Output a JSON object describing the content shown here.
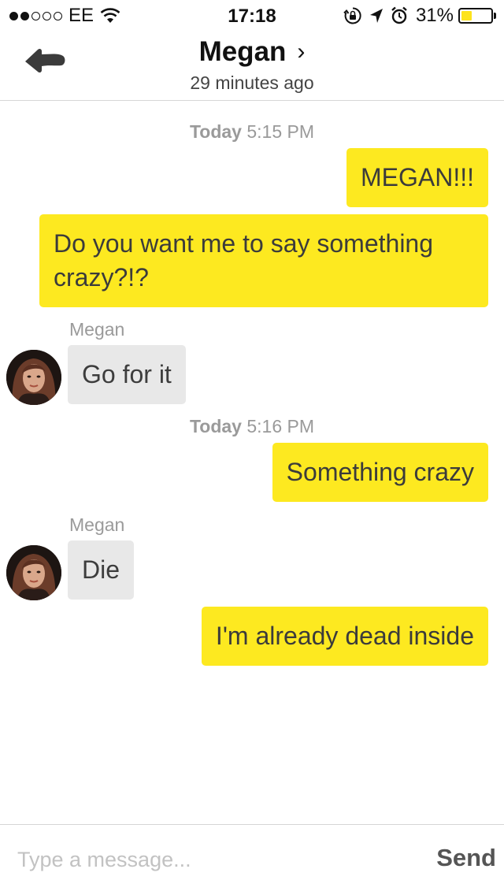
{
  "status_bar": {
    "carrier": "EE",
    "time": "17:18",
    "battery_percent": "31%",
    "battery_level": 0.31,
    "battery_fill_color": "#fde31d",
    "icons": [
      "signal-dots",
      "wifi-icon",
      "rotation-lock-icon",
      "location-arrow-icon",
      "alarm-icon",
      "battery-icon"
    ]
  },
  "header": {
    "back_icon": "back-arrow-icon",
    "title": "Megan",
    "title_chevron": "›",
    "subtitle": "29 minutes ago"
  },
  "messages": [
    {
      "type": "timestamp",
      "day": "Today",
      "time": "5:15 PM"
    },
    {
      "type": "outgoing",
      "text": "MEGAN!!!"
    },
    {
      "type": "outgoing",
      "text": "Do you want me to say something crazy?!?"
    },
    {
      "type": "incoming",
      "sender": "Megan",
      "text": "Go for it"
    },
    {
      "type": "timestamp",
      "day": "Today",
      "time": "5:16 PM"
    },
    {
      "type": "outgoing",
      "text": "Something crazy"
    },
    {
      "type": "incoming",
      "sender": "Megan",
      "text": "Die"
    },
    {
      "type": "outgoing",
      "text": "I'm already dead inside"
    }
  ],
  "composer": {
    "placeholder": "Type a message...",
    "value": "",
    "send_label": "Send"
  },
  "colors": {
    "outgoing_bubble": "#fde920",
    "incoming_bubble": "#e8e8e8",
    "timestamp_text": "#9a9a9a"
  }
}
